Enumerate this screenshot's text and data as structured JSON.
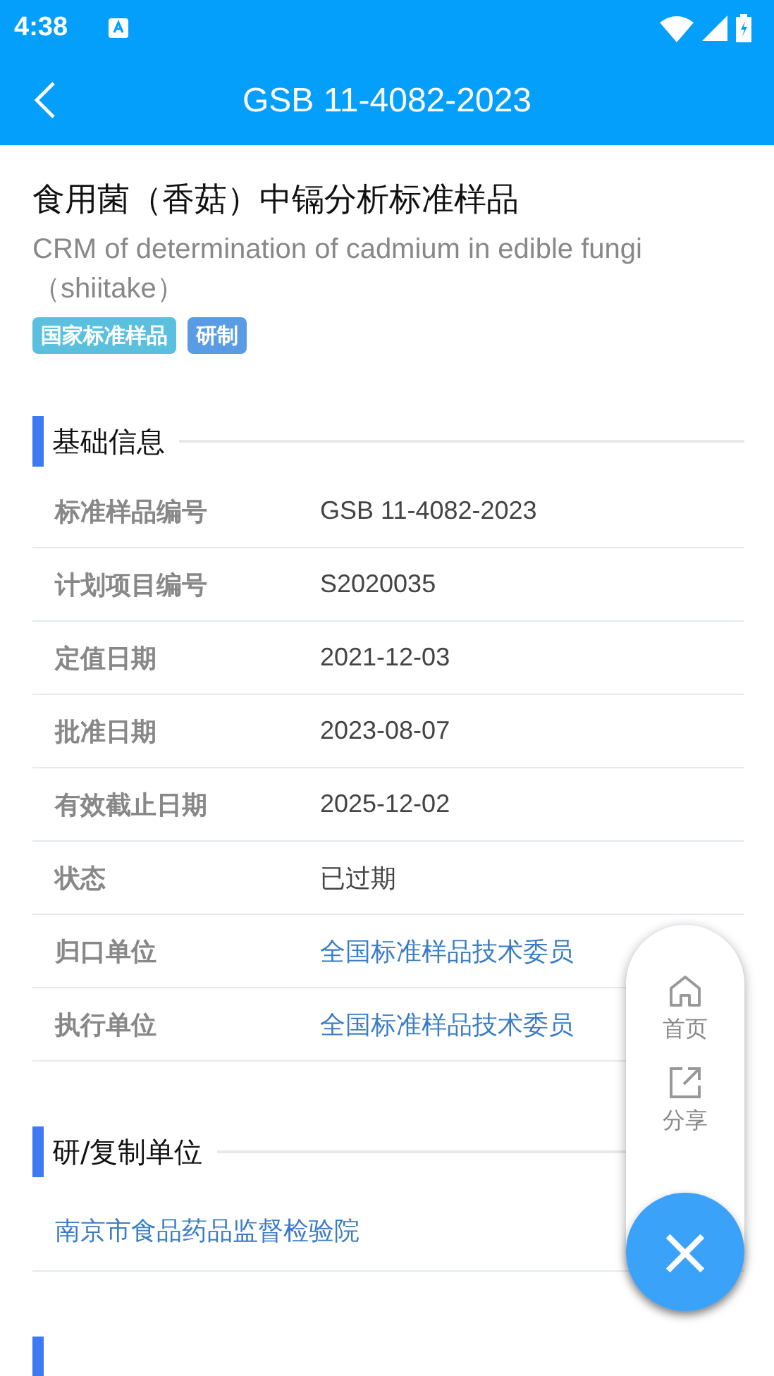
{
  "status_bar": {
    "time": "4:38"
  },
  "app_bar": {
    "title": "GSB 11-4082-2023"
  },
  "header": {
    "title": "食用菌（香菇）中镉分析标准样品",
    "subtitle": "CRM of determination of cadmium in edible fungi（shiitake）",
    "tags": [
      {
        "label": "国家标准样品",
        "color": "#5bc0de"
      },
      {
        "label": "研制",
        "color": "#5a9be6"
      }
    ]
  },
  "basic_info": {
    "heading": "基础信息",
    "rows": [
      {
        "label": "标准样品编号",
        "value": "GSB 11-4082-2023",
        "kind": "text"
      },
      {
        "label": "计划项目编号",
        "value": "S2020035",
        "kind": "text"
      },
      {
        "label": "定值日期",
        "value": "2021-12-03",
        "kind": "text"
      },
      {
        "label": "批准日期",
        "value": "2023-08-07",
        "kind": "text"
      },
      {
        "label": "有效截止日期",
        "value": "2025-12-02",
        "kind": "text"
      },
      {
        "label": "状态",
        "value": "已过期",
        "kind": "text"
      },
      {
        "label": "归口单位",
        "value": "全国标准样品技术委员",
        "kind": "link"
      },
      {
        "label": "执行单位",
        "value": "全国标准样品技术委员",
        "kind": "link"
      }
    ]
  },
  "developer": {
    "heading": "研/复制单位",
    "items": [
      "南京市食品药品监督检验院"
    ]
  },
  "fab_menu": {
    "items": [
      {
        "label": "首页",
        "kind": "home"
      },
      {
        "label": "分享",
        "kind": "share"
      }
    ],
    "close": "×"
  }
}
